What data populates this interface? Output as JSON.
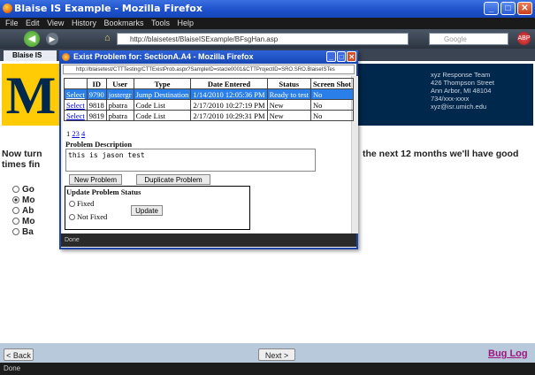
{
  "window": {
    "title": "Blaise IS Example - Mozilla Firefox"
  },
  "menu": [
    "File",
    "Edit",
    "View",
    "History",
    "Bookmarks",
    "Tools",
    "Help"
  ],
  "nav": {
    "url": "http://blaisetest/BlaiseISExample/BFsgHan.asp",
    "search_placeholder": "Google"
  },
  "tab": {
    "label": "Blaise IS"
  },
  "page": {
    "address_lines": [
      "xyz Response Team",
      "426 Thompson Street",
      "Ann Arbor, MI 48104",
      "734/xxx-xxxx",
      "xyz@isr.umich.edu"
    ],
    "question_left": "Now turn times fin",
    "question_right": "the next 12 months we'll have good",
    "options": [
      "Go",
      "Mo",
      "Ab",
      "Mo",
      "Ba"
    ],
    "selected_option": 1,
    "back_label": "< Back",
    "next_label": "Next >",
    "buglog_label": "Bug Log"
  },
  "popup": {
    "title": "Exist Problem for: SectionA.A4 - Mozilla Firefox",
    "url": "http://blaisetest/CTTTesting/CTTExistProb.aspx?SampleID=stacle0001&CTTProjectID=SRO.SRO.BlaiseISTes",
    "columns": [
      "",
      "ID",
      "User",
      "Type",
      "Date Entered",
      "Status",
      "Screen Shot"
    ],
    "rows": [
      {
        "action": "Select",
        "id": "9790",
        "user": "jostergr",
        "type": "Jump Destination",
        "date": "1/14/2010 12:05:36 PM",
        "status": "Ready to test",
        "screenshot": "No",
        "selected": true
      },
      {
        "action": "Select",
        "id": "9818",
        "user": "pbatra",
        "type": "Code List",
        "date": "2/17/2010 10:27:19 PM",
        "status": "New",
        "screenshot": "No",
        "selected": false
      },
      {
        "action": "Select",
        "id": "9819",
        "user": "pbatra",
        "type": "Code List",
        "date": "2/17/2010 10:29:31 PM",
        "status": "New",
        "screenshot": "No",
        "selected": false
      }
    ],
    "pages": [
      "1",
      "3",
      "4"
    ],
    "current_page_link": "2",
    "problem_description_label": "Problem Description",
    "problem_description_value": "this is jason test",
    "new_problem_label": "New Problem",
    "duplicate_problem_label": "Duplicate Problem",
    "update_status_label": "Update Problem Status",
    "fixed_label": "Fixed",
    "not_fixed_label": "Not Fixed",
    "update_label": "Update",
    "status_text": "Done"
  },
  "status_text": "Done"
}
